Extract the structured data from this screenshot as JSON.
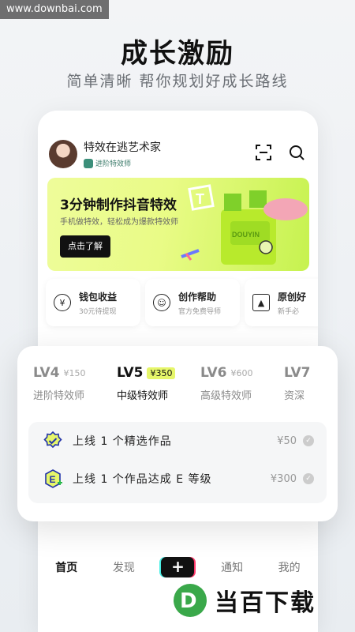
{
  "watermark": "www.downbai.com",
  "hero": {
    "title": "成长激励",
    "subtitle": "简单清晰 帮你规划好成长路线"
  },
  "profile": {
    "name": "特效在逃艺术家",
    "badge": "进阶特效师"
  },
  "icons": {
    "scan": "scan-icon",
    "search": "search-icon"
  },
  "banner": {
    "title": "3分钟制作抖音特效",
    "subtitle": "手机做特效，轻松成为爆款特效师",
    "cta": "点击了解",
    "art_text": "DOUYIN",
    "colors": {
      "bg": "#e9fb86",
      "cta_bg": "#111111"
    }
  },
  "tools": [
    {
      "icon": "yen-coin-icon",
      "label": "钱包收益",
      "desc": "30元待提现"
    },
    {
      "icon": "chat-smile-icon",
      "label": "创作帮助",
      "desc": "官方免费导师"
    },
    {
      "icon": "graduation-cap-icon",
      "label": "原创好",
      "desc": "新手必"
    }
  ],
  "levels": [
    {
      "name": "LV4",
      "price": "¥150",
      "title": "进阶特效师",
      "active": false
    },
    {
      "name": "LV5",
      "price": "¥350",
      "title": "中级特效师",
      "active": true
    },
    {
      "name": "LV6",
      "price": "¥600",
      "title": "高级特效师",
      "active": false
    },
    {
      "name": "LV7",
      "price": "",
      "title": "资深",
      "active": false
    }
  ],
  "tasks": [
    {
      "icon": "badge-check-icon",
      "text": "上线 1 个精选作品",
      "reward": "¥50"
    },
    {
      "icon": "grade-e-icon",
      "icon_letter": "E",
      "text": "上线 1 个作品达成 E 等级",
      "reward": "¥300"
    }
  ],
  "tabbar": {
    "home": "首页",
    "discover": "发现",
    "add": "+",
    "notify": "通知",
    "me": "我的"
  },
  "logo": {
    "mark": "D",
    "text": "当百下载"
  },
  "colors": {
    "accent": "#e6f66a",
    "logo_green": "#3aa84a"
  }
}
